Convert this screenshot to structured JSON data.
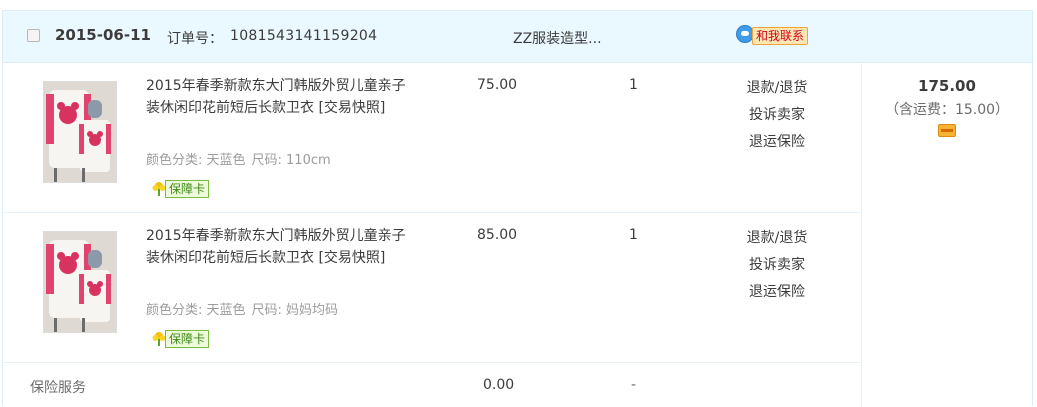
{
  "order": {
    "date": "2015-06-11",
    "order_label": "订单号：",
    "order_number": "1081543141159204",
    "shop_name": "ZZ服装造型...",
    "contact_label": "和我联系",
    "total": "175.00",
    "freight": "（含运费：15.00）"
  },
  "items": [
    {
      "title": "2015年春季新款东大门韩版外贸儿童亲子装休闲印花前短后长款卫衣 [交易快照]",
      "sku_color": "颜色分类: 天蓝色",
      "sku_size": "尺码: 110cm",
      "guarantee": "保障卡",
      "price": "75.00",
      "quantity": "1",
      "ops": [
        "退款/退货",
        "投诉卖家",
        "退运保险"
      ]
    },
    {
      "title": "2015年春季新款东大门韩版外贸儿童亲子装休闲印花前短后长款卫衣 [交易快照]",
      "sku_color": "颜色分类: 天蓝色",
      "sku_size": "尺码: 妈妈均码",
      "guarantee": "保障卡",
      "price": "85.00",
      "quantity": "1",
      "ops": [
        "退款/退货",
        "投诉卖家",
        "退运保险"
      ]
    }
  ],
  "service": {
    "name": "保险服务",
    "amount": "0.00",
    "dash": "-"
  },
  "colors": {
    "header_bg": "#eaf8ff",
    "border": "#dcedf7",
    "text": "#3c3c3c",
    "muted": "#9c9c9c"
  }
}
